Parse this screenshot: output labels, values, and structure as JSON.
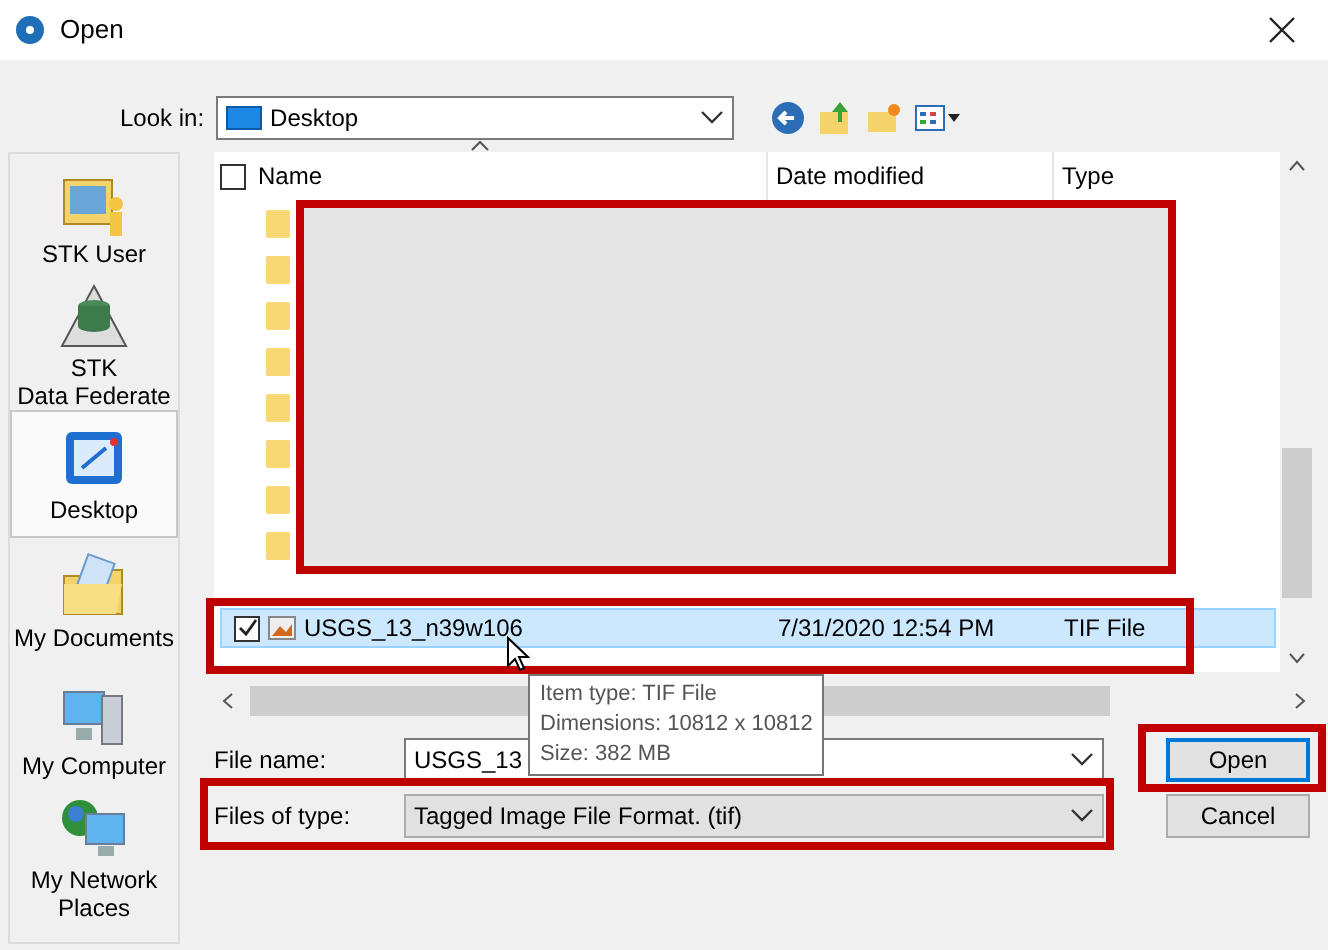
{
  "window": {
    "title": "Open"
  },
  "look_in": {
    "label": "Look in:",
    "value": "Desktop"
  },
  "places": [
    {
      "label": "STK User",
      "selected": false,
      "kind": "user"
    },
    {
      "label": "STK\nData Federate",
      "selected": false,
      "kind": "database"
    },
    {
      "label": "Desktop",
      "selected": true,
      "kind": "desktop"
    },
    {
      "label": "My Documents",
      "selected": false,
      "kind": "documents"
    },
    {
      "label": "My Computer",
      "selected": false,
      "kind": "computer"
    },
    {
      "label": "My Network\nPlaces",
      "selected": false,
      "kind": "network"
    }
  ],
  "select_all": {
    "checked": false
  },
  "columns": [
    "Name",
    "Date modified",
    "Type"
  ],
  "file": {
    "name": "USGS_13_n39w106",
    "date": "7/31/2020 12:54 PM",
    "type": "TIF File",
    "checked": true,
    "selected": true
  },
  "tooltip": [
    "Item type: TIF File",
    "Dimensions: 10812 x 10812",
    "Size: 382 MB"
  ],
  "file_name": {
    "label": "File name:",
    "value": "USGS_13"
  },
  "file_type": {
    "label": "Files of type:",
    "value": "Tagged Image File Format. (tif)"
  },
  "buttons": [
    "Open",
    "Cancel"
  ]
}
